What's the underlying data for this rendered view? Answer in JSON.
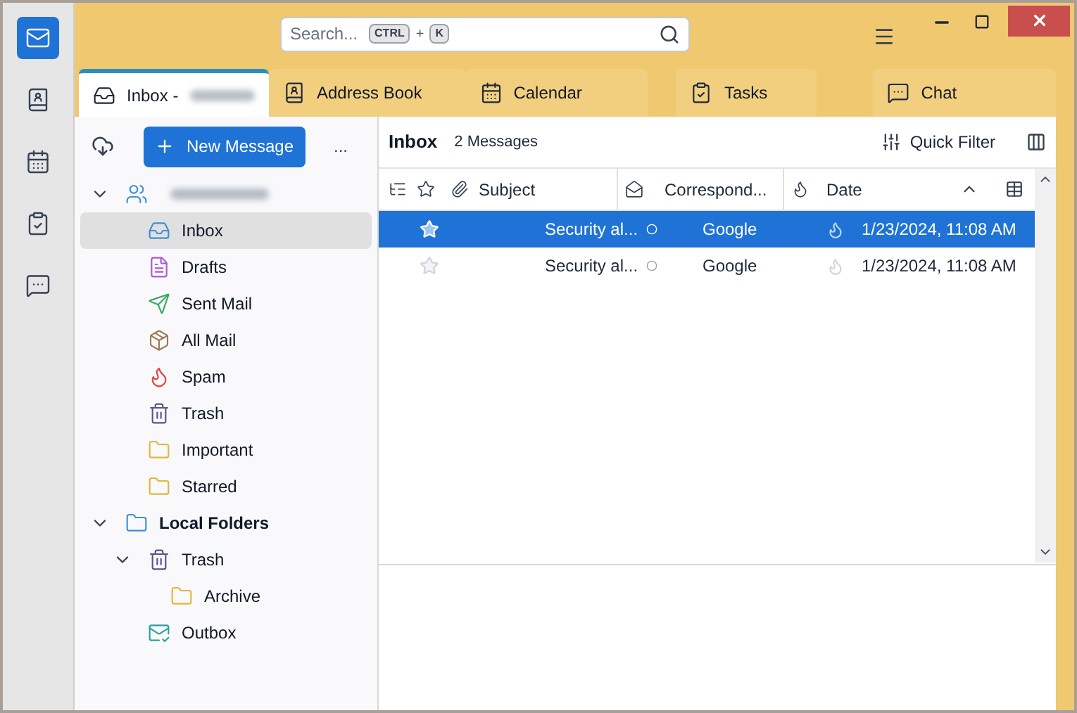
{
  "search": {
    "placeholder": "Search...",
    "shortcut_keys": [
      "CTRL",
      "K"
    ],
    "joiner": "+"
  },
  "tabs": [
    {
      "label": "Inbox -",
      "kind": "inbox",
      "selected": true,
      "redacted": true
    },
    {
      "label": "Address Book",
      "kind": "contacts",
      "selected": false
    },
    {
      "label": "Calendar",
      "kind": "calendar",
      "selected": false
    },
    {
      "label": "Tasks",
      "kind": "tasks",
      "selected": false
    },
    {
      "label": "Chat",
      "kind": "chat",
      "selected": false
    }
  ],
  "spaces": [
    {
      "kind": "mail",
      "selected": true
    },
    {
      "kind": "contacts",
      "selected": false
    },
    {
      "kind": "calendar",
      "selected": false
    },
    {
      "kind": "tasks",
      "selected": false
    },
    {
      "kind": "chat",
      "selected": false
    }
  ],
  "folder_pane": {
    "new_message": "New Message",
    "more": "...",
    "folders": [
      {
        "kind": "account",
        "redacted": true,
        "expanded": true,
        "selected": false,
        "children": [
          {
            "label": "Inbox",
            "kind": "inbox",
            "selected": true
          },
          {
            "label": "Drafts",
            "kind": "drafts",
            "selected": false
          },
          {
            "label": "Sent Mail",
            "kind": "sent",
            "selected": false
          },
          {
            "label": "All Mail",
            "kind": "archive",
            "selected": false
          },
          {
            "label": "Spam",
            "kind": "spam",
            "selected": false
          },
          {
            "label": "Trash",
            "kind": "trash",
            "selected": false
          },
          {
            "label": "Important",
            "kind": "folder",
            "selected": false
          },
          {
            "label": "Starred",
            "kind": "folder",
            "selected": false
          }
        ]
      },
      {
        "kind": "localfolder",
        "label": "Local Folders",
        "expanded": true,
        "selected": false,
        "children": [
          {
            "label": "Trash",
            "kind": "trash",
            "expanded": true,
            "selected": false,
            "children": [
              {
                "label": "Archive",
                "kind": "folder",
                "selected": false
              }
            ]
          },
          {
            "label": "Outbox",
            "kind": "outbox",
            "selected": false
          }
        ]
      }
    ]
  },
  "message_list": {
    "folder": "Inbox",
    "count": "2 Messages",
    "quick_filter": "Quick Filter",
    "columns": [
      {
        "kind": "thread"
      },
      {
        "kind": "star"
      },
      {
        "kind": "attachment"
      },
      {
        "kind": "text",
        "label": "Subject"
      },
      {
        "kind": "unread"
      },
      {
        "kind": "text",
        "label": "Correspond..."
      },
      {
        "kind": "junk"
      },
      {
        "kind": "text",
        "label": "Date",
        "sorted": true
      }
    ],
    "rows": [
      {
        "subject": "Security al...",
        "correspondent": "Google",
        "date": "1/23/2024, 11:08 AM",
        "selected": true,
        "starred": false
      },
      {
        "subject": "Security al...",
        "correspondent": "Google",
        "date": "1/23/2024, 11:08 AM",
        "selected": false,
        "starred": false
      }
    ]
  }
}
